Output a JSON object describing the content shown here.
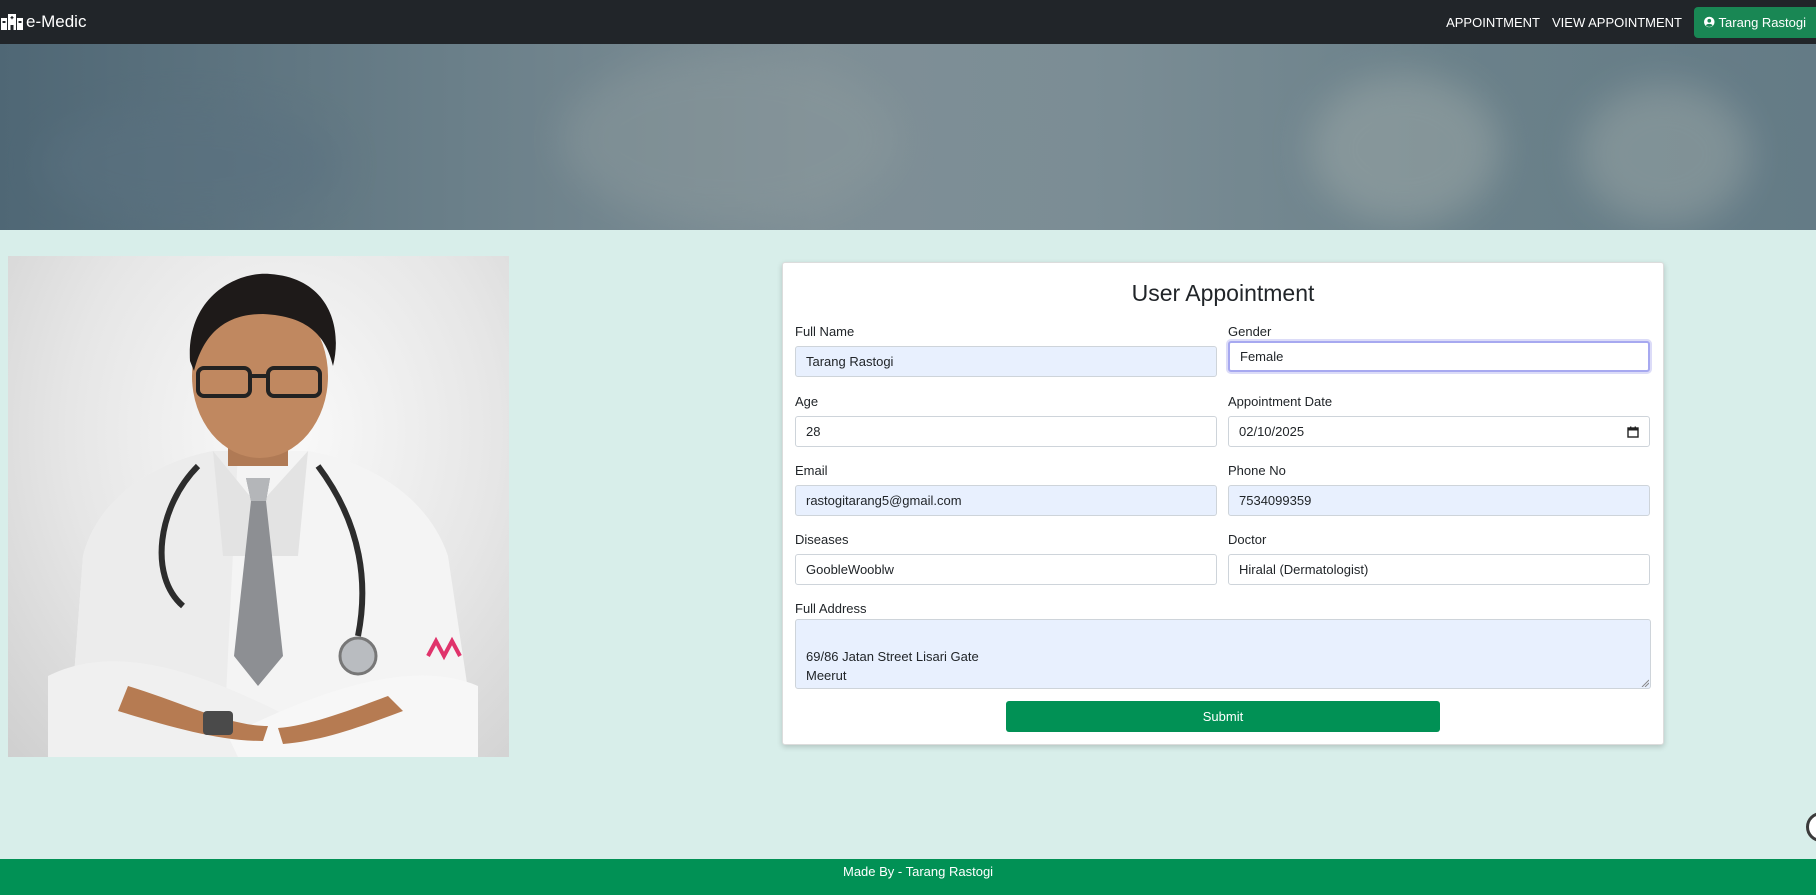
{
  "navbar": {
    "brand": "e-Medic",
    "links": [
      "APPOINTMENT",
      "VIEW APPOINTMENT"
    ],
    "user": "Tarang Rastogi"
  },
  "form": {
    "title": "User Appointment",
    "full_name": {
      "label": "Full Name",
      "value": "Tarang Rastogi"
    },
    "gender": {
      "label": "Gender",
      "value": "Female"
    },
    "age": {
      "label": "Age",
      "value": "28"
    },
    "appointment_date": {
      "label": "Appointment Date",
      "value": "02/10/2025"
    },
    "email": {
      "label": "Email",
      "value": "rastogitarang5@gmail.com"
    },
    "phone": {
      "label": "Phone No",
      "value": "7534099359"
    },
    "diseases": {
      "label": "Diseases",
      "value": "GoobleWooblw"
    },
    "doctor": {
      "label": "Doctor",
      "value": "Hiralal (Dermatologist)"
    },
    "address": {
      "label": "Full Address",
      "value": "69/86 Jatan Street Lisari Gate\nMeerut"
    },
    "submit_label": "Submit"
  },
  "footer": {
    "text": "Made By - Tarang Rastogi"
  },
  "colors": {
    "navbar": "#212529",
    "accent": "#019155",
    "background": "#d8eeea",
    "autofill": "#e8f0fe"
  }
}
